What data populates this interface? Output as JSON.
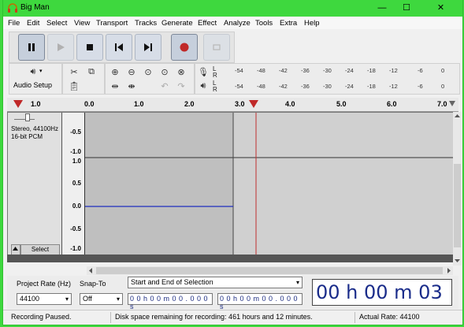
{
  "window": {
    "title": "Big Man",
    "minimize": "—",
    "maximize": "☐",
    "close": "✕"
  },
  "menu": [
    "File",
    "Edit",
    "Select",
    "View",
    "Transport",
    "Tracks",
    "Generate",
    "Effect",
    "Analyze",
    "Tools",
    "Extra",
    "Help"
  ],
  "toolbar": {
    "audio_setup": "Audio Setup"
  },
  "meters": {
    "record_ticks": [
      "-54",
      "-48",
      "-42",
      "-36",
      "-30",
      "-24",
      "-18",
      "-12",
      "-6",
      "0"
    ],
    "play_ticks": [
      "-54",
      "-48",
      "-42",
      "-36",
      "-30",
      "-24",
      "-18",
      "-12",
      "-6",
      "0"
    ],
    "rec_label_l": "L",
    "rec_label_r": "R",
    "play_label_l": "L",
    "play_label_r": "R"
  },
  "ruler": {
    "labels": [
      "1.0",
      "0.0",
      "1.0",
      "2.0",
      "3.0",
      "4.0",
      "5.0",
      "6.0",
      "7.0"
    ]
  },
  "track": {
    "info": "Stereo, 44100Hz\n16-bit PCM",
    "info_line1": "Stereo, 44100Hz",
    "info_line2": "16-bit PCM",
    "select_label": "Select",
    "vruler_top": [
      "-0.5",
      "-1.0"
    ],
    "vruler_bottom": [
      "1.0",
      "0.5",
      "0.0",
      "-0.5",
      "-1.0"
    ],
    "vruler_div": "1.0"
  },
  "selection_toolbar": {
    "project_rate_label": "Project Rate (Hz)",
    "project_rate_value": "44100",
    "snap_to_label": "Snap-To",
    "snap_to_value": "Off",
    "selection_mode": "Start and End of Selection",
    "start_time": "0 0 h 0 0 m 0 0 . 0 0 0 s",
    "end_time": "0 0 h 0 0 m 0 0 . 0 0 0 s",
    "big_time": "00 h 00 m 03 s"
  },
  "status": {
    "state": "Recording Paused.",
    "disk": "Disk space remaining for recording: 461 hours and 12 minutes.",
    "rate": "Actual Rate: 44100"
  },
  "colors": {
    "titlebar": "#3ed83e",
    "waveform": "#1f2dbf",
    "cursor": "#c03030",
    "record": "#c02828"
  }
}
